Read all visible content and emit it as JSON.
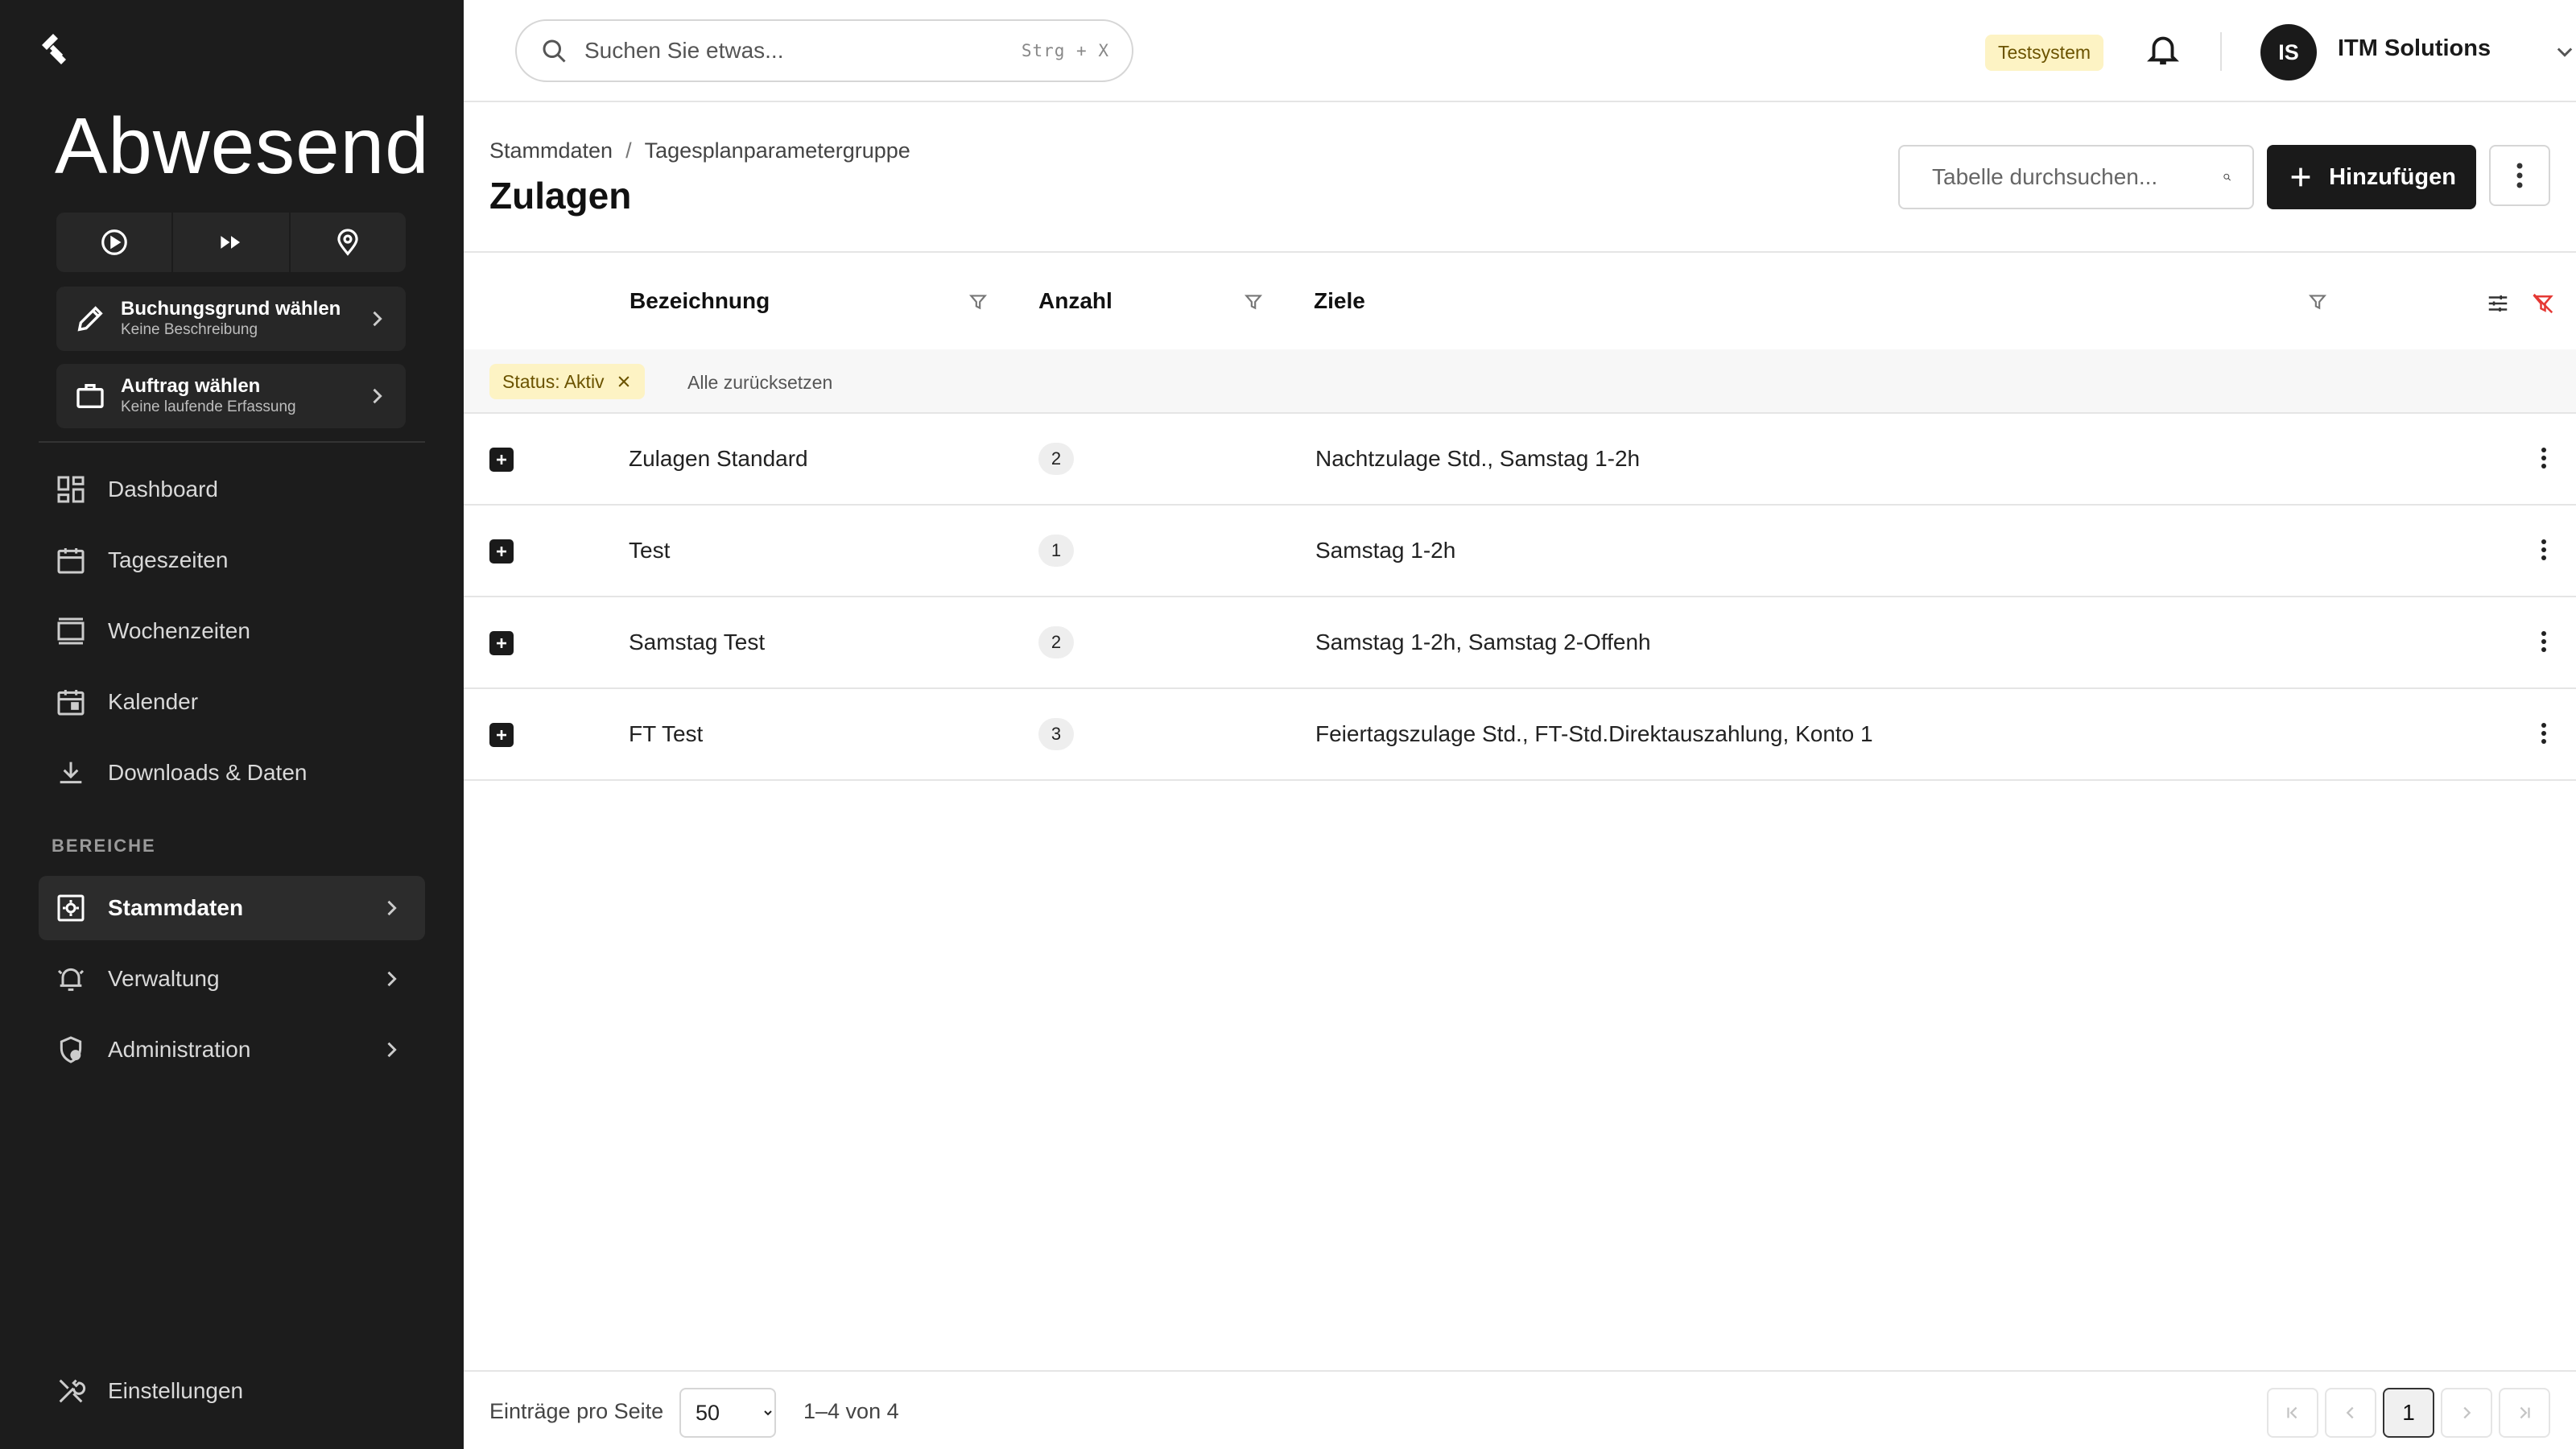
{
  "sidebar": {
    "status_title": "Abwesend",
    "actions": [
      {
        "icon": "play-circle-icon"
      },
      {
        "icon": "fast-forward-icon"
      },
      {
        "icon": "location-pin-icon"
      }
    ],
    "booking_reason": {
      "title": "Buchungsgrund wählen",
      "subtitle": "Keine Beschreibung"
    },
    "order": {
      "title": "Auftrag wählen",
      "subtitle": "Keine laufende Erfassung"
    },
    "nav": [
      {
        "label": "Dashboard",
        "icon": "dashboard-icon"
      },
      {
        "label": "Tageszeiten",
        "icon": "calendar-icon"
      },
      {
        "label": "Wochenzeiten",
        "icon": "week-view-icon"
      },
      {
        "label": "Kalender",
        "icon": "calendar-event-icon"
      },
      {
        "label": "Downloads & Daten",
        "icon": "download-icon"
      }
    ],
    "section_label": "BEREICHE",
    "sections": [
      {
        "label": "Stammdaten",
        "icon": "master-data-icon",
        "active": true
      },
      {
        "label": "Verwaltung",
        "icon": "alarm-bell-icon",
        "active": false
      },
      {
        "label": "Administration",
        "icon": "shield-user-icon",
        "active": false
      }
    ],
    "settings_label": "Einstellungen"
  },
  "header": {
    "search_placeholder": "Suchen Sie etwas...",
    "search_shortcut": "Strg + X",
    "env_badge": "Testsystem",
    "avatar_initials": "IS",
    "company": "ITM Solutions"
  },
  "page": {
    "breadcrumb": [
      "Stammdaten",
      "Tagesplanparametergruppe"
    ],
    "title": "Zulagen",
    "table_search_placeholder": "Tabelle durchsuchen...",
    "add_label": "Hinzufügen"
  },
  "table": {
    "columns": {
      "name": "Bezeichnung",
      "count": "Anzahl",
      "targets": "Ziele"
    },
    "filter_chip": "Status: Aktiv",
    "reset_label": "Alle zurücksetzen",
    "rows": [
      {
        "name": "Zulagen Standard",
        "count": "2",
        "targets": "Nachtzulage Std., Samstag 1-2h"
      },
      {
        "name": "Test",
        "count": "1",
        "targets": "Samstag 1-2h"
      },
      {
        "name": "Samstag Test",
        "count": "2",
        "targets": "Samstag 1-2h, Samstag 2-Offenh"
      },
      {
        "name": "FT Test",
        "count": "3",
        "targets": "Feiertagszulage Std., FT-Std.Direktauszahlung, Konto 1"
      }
    ]
  },
  "footer": {
    "per_page_label": "Einträge pro Seite",
    "per_page_value": "50",
    "range": "1–4 von 4",
    "current_page": "1"
  },
  "colors": {
    "sidebar_bg": "#1c1c1c",
    "primary": "#1a1a1a",
    "badge_bg": "#fdf3c4",
    "reset_filter_red": "#e53935"
  }
}
